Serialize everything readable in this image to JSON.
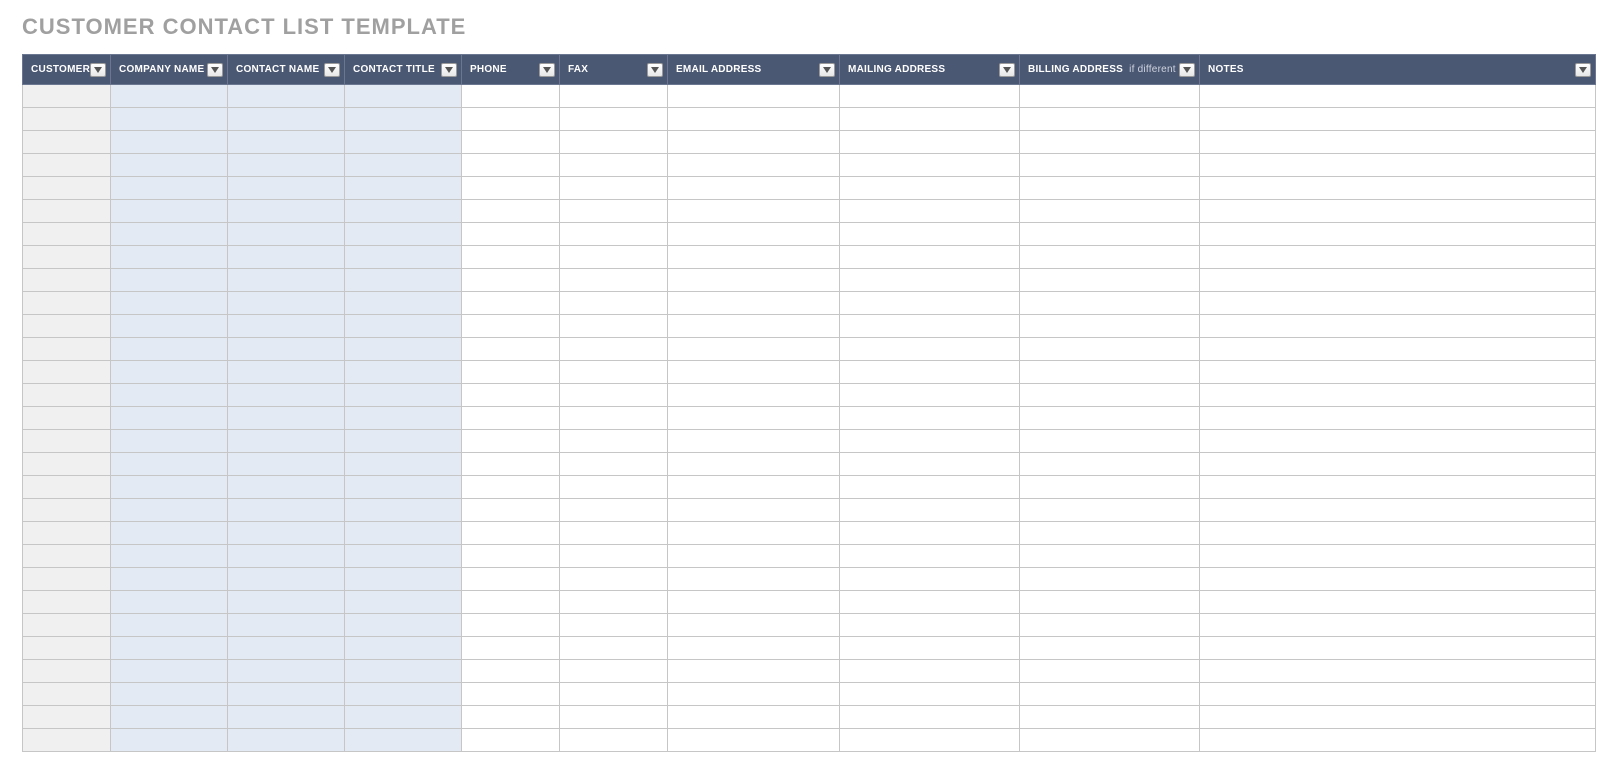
{
  "title": "CUSTOMER CONTACT LIST TEMPLATE",
  "columns": [
    {
      "label": "CUSTOMER ID",
      "sub": ""
    },
    {
      "label": "COMPANY NAME",
      "sub": ""
    },
    {
      "label": "CONTACT NAME",
      "sub": ""
    },
    {
      "label": "CONTACT TITLE",
      "sub": ""
    },
    {
      "label": "PHONE",
      "sub": ""
    },
    {
      "label": "FAX",
      "sub": ""
    },
    {
      "label": "EMAIL ADDRESS",
      "sub": ""
    },
    {
      "label": "MAILING ADDRESS",
      "sub": ""
    },
    {
      "label": "BILLING ADDRESS",
      "sub": "if different"
    },
    {
      "label": "NOTES",
      "sub": ""
    }
  ],
  "row_count": 29,
  "rows": [
    [
      "",
      "",
      "",
      "",
      "",
      "",
      "",
      "",
      "",
      ""
    ],
    [
      "",
      "",
      "",
      "",
      "",
      "",
      "",
      "",
      "",
      ""
    ],
    [
      "",
      "",
      "",
      "",
      "",
      "",
      "",
      "",
      "",
      ""
    ],
    [
      "",
      "",
      "",
      "",
      "",
      "",
      "",
      "",
      "",
      ""
    ],
    [
      "",
      "",
      "",
      "",
      "",
      "",
      "",
      "",
      "",
      ""
    ],
    [
      "",
      "",
      "",
      "",
      "",
      "",
      "",
      "",
      "",
      ""
    ],
    [
      "",
      "",
      "",
      "",
      "",
      "",
      "",
      "",
      "",
      ""
    ],
    [
      "",
      "",
      "",
      "",
      "",
      "",
      "",
      "",
      "",
      ""
    ],
    [
      "",
      "",
      "",
      "",
      "",
      "",
      "",
      "",
      "",
      ""
    ],
    [
      "",
      "",
      "",
      "",
      "",
      "",
      "",
      "",
      "",
      ""
    ],
    [
      "",
      "",
      "",
      "",
      "",
      "",
      "",
      "",
      "",
      ""
    ],
    [
      "",
      "",
      "",
      "",
      "",
      "",
      "",
      "",
      "",
      ""
    ],
    [
      "",
      "",
      "",
      "",
      "",
      "",
      "",
      "",
      "",
      ""
    ],
    [
      "",
      "",
      "",
      "",
      "",
      "",
      "",
      "",
      "",
      ""
    ],
    [
      "",
      "",
      "",
      "",
      "",
      "",
      "",
      "",
      "",
      ""
    ],
    [
      "",
      "",
      "",
      "",
      "",
      "",
      "",
      "",
      "",
      ""
    ],
    [
      "",
      "",
      "",
      "",
      "",
      "",
      "",
      "",
      "",
      ""
    ],
    [
      "",
      "",
      "",
      "",
      "",
      "",
      "",
      "",
      "",
      ""
    ],
    [
      "",
      "",
      "",
      "",
      "",
      "",
      "",
      "",
      "",
      ""
    ],
    [
      "",
      "",
      "",
      "",
      "",
      "",
      "",
      "",
      "",
      ""
    ],
    [
      "",
      "",
      "",
      "",
      "",
      "",
      "",
      "",
      "",
      ""
    ],
    [
      "",
      "",
      "",
      "",
      "",
      "",
      "",
      "",
      "",
      ""
    ],
    [
      "",
      "",
      "",
      "",
      "",
      "",
      "",
      "",
      "",
      ""
    ],
    [
      "",
      "",
      "",
      "",
      "",
      "",
      "",
      "",
      "",
      ""
    ],
    [
      "",
      "",
      "",
      "",
      "",
      "",
      "",
      "",
      "",
      ""
    ],
    [
      "",
      "",
      "",
      "",
      "",
      "",
      "",
      "",
      "",
      ""
    ],
    [
      "",
      "",
      "",
      "",
      "",
      "",
      "",
      "",
      "",
      ""
    ],
    [
      "",
      "",
      "",
      "",
      "",
      "",
      "",
      "",
      "",
      ""
    ],
    [
      "",
      "",
      "",
      "",
      "",
      "",
      "",
      "",
      "",
      ""
    ]
  ],
  "colors": {
    "header_bg": "#4b5873",
    "id_col_bg": "#f0f0f0",
    "blue_col_bg": "#e4eaf3",
    "border": "#c6c6c6",
    "title_gray": "#a0a0a0"
  }
}
